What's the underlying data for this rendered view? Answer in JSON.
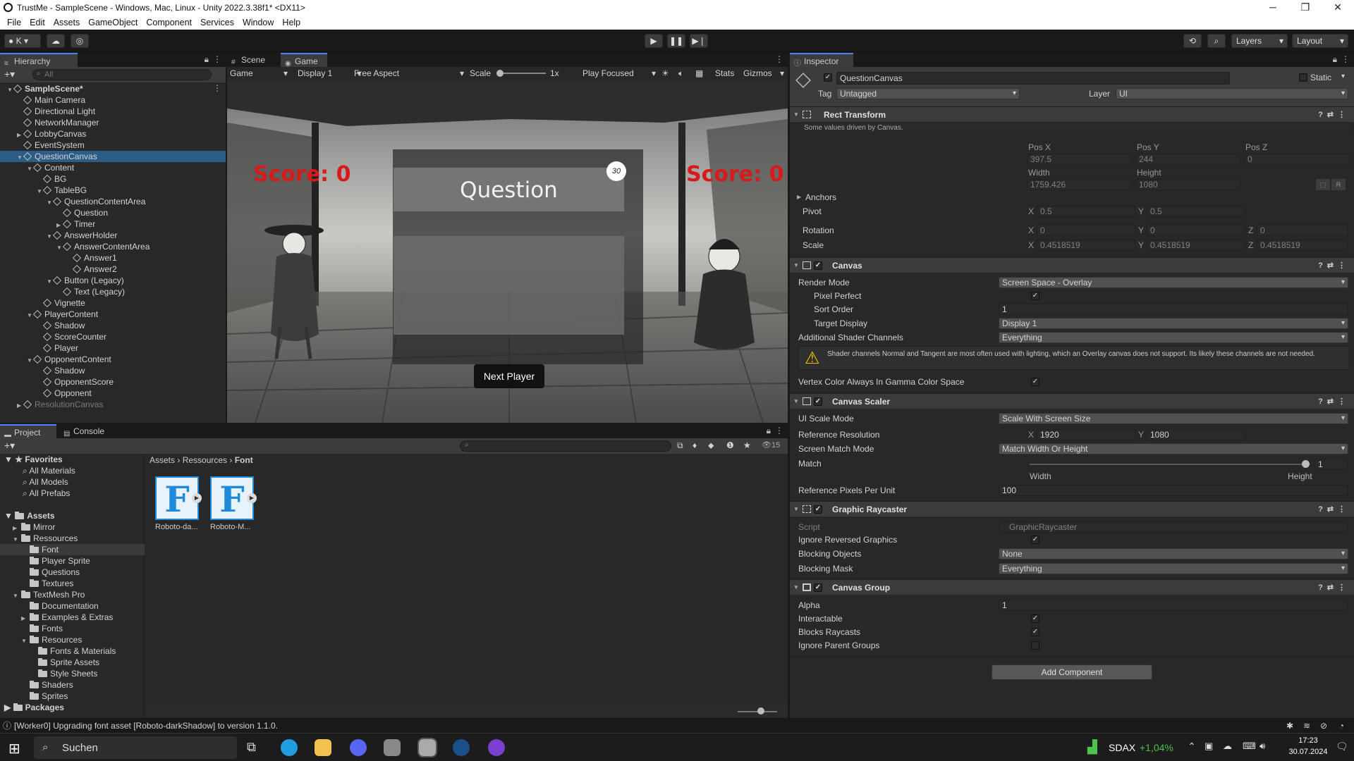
{
  "window": {
    "title": "TrustMe - SampleScene - Windows, Mac, Linux - Unity 2022.3.38f1* <DX11>"
  },
  "menu": [
    "File",
    "Edit",
    "Assets",
    "GameObject",
    "Component",
    "Services",
    "Window",
    "Help"
  ],
  "toolbar": {
    "account": "K",
    "layers": "Layers",
    "layout": "Layout"
  },
  "hierarchy": {
    "tab": "Hierarchy",
    "search_placeholder": "All",
    "rows": [
      {
        "label": "SampleScene*",
        "depth": 0,
        "arrow": "▼",
        "kind": "scene"
      },
      {
        "label": "Main Camera",
        "depth": 1,
        "arrow": ""
      },
      {
        "label": "Directional Light",
        "depth": 1,
        "arrow": ""
      },
      {
        "label": "NetworkManager",
        "depth": 1,
        "arrow": ""
      },
      {
        "label": "LobbyCanvas",
        "depth": 1,
        "arrow": "▶"
      },
      {
        "label": "EventSystem",
        "depth": 1,
        "arrow": ""
      },
      {
        "label": "QuestionCanvas",
        "depth": 1,
        "arrow": "▼",
        "selected": true
      },
      {
        "label": "Content",
        "depth": 2,
        "arrow": "▼"
      },
      {
        "label": "BG",
        "depth": 3,
        "arrow": ""
      },
      {
        "label": "TableBG",
        "depth": 3,
        "arrow": "▼"
      },
      {
        "label": "QuestionContentArea",
        "depth": 4,
        "arrow": "▼"
      },
      {
        "label": "Question",
        "depth": 5,
        "arrow": ""
      },
      {
        "label": "Timer",
        "depth": 5,
        "arrow": "▶"
      },
      {
        "label": "AnswerHolder",
        "depth": 4,
        "arrow": "▼"
      },
      {
        "label": "AnswerContentArea",
        "depth": 5,
        "arrow": "▼"
      },
      {
        "label": "Answer1",
        "depth": 6,
        "arrow": ""
      },
      {
        "label": "Answer2",
        "depth": 6,
        "arrow": ""
      },
      {
        "label": "Button (Legacy)",
        "depth": 4,
        "arrow": "▼"
      },
      {
        "label": "Text (Legacy)",
        "depth": 5,
        "arrow": ""
      },
      {
        "label": "Vignette",
        "depth": 3,
        "arrow": ""
      },
      {
        "label": "PlayerContent",
        "depth": 2,
        "arrow": "▼"
      },
      {
        "label": "Shadow",
        "depth": 3,
        "arrow": ""
      },
      {
        "label": "ScoreCounter",
        "depth": 3,
        "arrow": ""
      },
      {
        "label": "Player",
        "depth": 3,
        "arrow": ""
      },
      {
        "label": "OpponentContent",
        "depth": 2,
        "arrow": "▼"
      },
      {
        "label": "Shadow",
        "depth": 3,
        "arrow": ""
      },
      {
        "label": "OpponentScore",
        "depth": 3,
        "arrow": ""
      },
      {
        "label": "Opponent",
        "depth": 3,
        "arrow": ""
      },
      {
        "label": "ResolutionCanvas",
        "depth": 1,
        "arrow": "▶",
        "dim": true
      }
    ]
  },
  "game": {
    "tabs": [
      "Scene",
      "Game"
    ],
    "mode": "Game",
    "display": "Display 1",
    "aspect": "Free Aspect",
    "scale_label": "Scale",
    "scale_value": "1x",
    "play_focused": "Play Focused",
    "stats": "Stats",
    "gizmos": "Gizmos",
    "score_left": "Score: 0",
    "score_right": "Score: 0",
    "question": "Question",
    "timer": "30",
    "next_button": "Next Player"
  },
  "project": {
    "tabs": [
      "Project",
      "Console"
    ],
    "favorites_label": "Favorites",
    "favorites": [
      "All Materials",
      "All Models",
      "All Prefabs"
    ],
    "assets_label": "Assets",
    "tree": [
      {
        "label": "Mirror",
        "depth": 1,
        "arrow": "▶"
      },
      {
        "label": "Ressources",
        "depth": 1,
        "arrow": "▼"
      },
      {
        "label": "Font",
        "depth": 2,
        "arrow": "",
        "selected": true
      },
      {
        "label": "Player Sprite",
        "depth": 2,
        "arrow": ""
      },
      {
        "label": "Questions",
        "depth": 2,
        "arrow": ""
      },
      {
        "label": "Textures",
        "depth": 2,
        "arrow": ""
      },
      {
        "label": "TextMesh Pro",
        "depth": 1,
        "arrow": "▼"
      },
      {
        "label": "Documentation",
        "depth": 2,
        "arrow": ""
      },
      {
        "label": "Examples & Extras",
        "depth": 2,
        "arrow": "▶"
      },
      {
        "label": "Fonts",
        "depth": 2,
        "arrow": ""
      },
      {
        "label": "Resources",
        "depth": 2,
        "arrow": "▼"
      },
      {
        "label": "Fonts & Materials",
        "depth": 3,
        "arrow": ""
      },
      {
        "label": "Sprite Assets",
        "depth": 3,
        "arrow": ""
      },
      {
        "label": "Style Sheets",
        "depth": 3,
        "arrow": ""
      },
      {
        "label": "Shaders",
        "depth": 2,
        "arrow": ""
      },
      {
        "label": "Sprites",
        "depth": 2,
        "arrow": ""
      }
    ],
    "packages_label": "Packages",
    "breadcrumb": [
      "Assets",
      "Ressources",
      "Font"
    ],
    "files": [
      "Roboto-da...",
      "Roboto-M..."
    ],
    "hidden_count": "15"
  },
  "inspector": {
    "tab": "Inspector",
    "object_name": "QuestionCanvas",
    "static_label": "Static",
    "tag_label": "Tag",
    "tag": "Untagged",
    "layer_label": "Layer",
    "layer": "UI",
    "rect": {
      "title": "Rect Transform",
      "note": "Some values driven by Canvas.",
      "pos_x_label": "Pos X",
      "pos_y_label": "Pos Y",
      "pos_z_label": "Pos Z",
      "pos_x": "397.5",
      "pos_y": "244",
      "pos_z": "0",
      "width_label": "Width",
      "height_label": "Height",
      "width": "1759.426",
      "height": "1080",
      "anchors": "Anchors",
      "pivot": "Pivot",
      "pivot_x": "0.5",
      "pivot_y": "0.5",
      "rotation": "Rotation",
      "rot_x": "0",
      "rot_y": "0",
      "rot_z": "0",
      "scale": "Scale",
      "scale_x": "0.4518519",
      "scale_y": "0.4518519",
      "scale_z": "0.4518519"
    },
    "canvas": {
      "title": "Canvas",
      "render_mode_label": "Render Mode",
      "render_mode": "Screen Space - Overlay",
      "pixel_perfect": "Pixel Perfect",
      "sort_order_label": "Sort Order",
      "sort_order": "1",
      "target_display_label": "Target Display",
      "target_display": "Display 1",
      "shader_channels_label": "Additional Shader Channels",
      "shader_channels": "Everything",
      "warning": "Shader channels Normal and Tangent are most often used with lighting, which an Overlay canvas does not support. Its likely these channels are not needed.",
      "vertex_color": "Vertex Color Always In Gamma Color Space"
    },
    "scaler": {
      "title": "Canvas Scaler",
      "ui_scale_mode_label": "UI Scale Mode",
      "ui_scale_mode": "Scale With Screen Size",
      "ref_res_label": "Reference Resolution",
      "ref_x": "1920",
      "ref_y": "1080",
      "match_mode_label": "Screen Match Mode",
      "match_mode": "Match Width Or Height",
      "match_label": "Match",
      "match_value": "1",
      "match_fraction": 1.0,
      "width_word": "Width",
      "height_word": "Height",
      "ppu_label": "Reference Pixels Per Unit",
      "ppu": "100"
    },
    "raycaster": {
      "title": "Graphic Raycaster",
      "script_label": "Script",
      "script": "GraphicRaycaster",
      "ignore_reversed": "Ignore Reversed Graphics",
      "blocking_objects_label": "Blocking Objects",
      "blocking_objects": "None",
      "blocking_mask_label": "Blocking Mask",
      "blocking_mask": "Everything"
    },
    "group": {
      "title": "Canvas Group",
      "alpha_label": "Alpha",
      "alpha": "1",
      "interactable": "Interactable",
      "blocks_raycasts": "Blocks Raycasts",
      "ignore_parent": "Ignore Parent Groups"
    },
    "add_component": "Add Component"
  },
  "status": {
    "message": "[Worker0] Upgrading font asset [Roboto-darkShadow] to version 1.1.0."
  },
  "taskbar": {
    "search": "Suchen",
    "ticker": "SDAX",
    "ticker_change": "+1,04%",
    "time": "17:23",
    "date": "30.07.2024"
  },
  "colors": {
    "accent": "#4c7eff",
    "selection": "#2c5d87",
    "score": "#d91a1a",
    "ticker_up": "#4cc34c"
  }
}
